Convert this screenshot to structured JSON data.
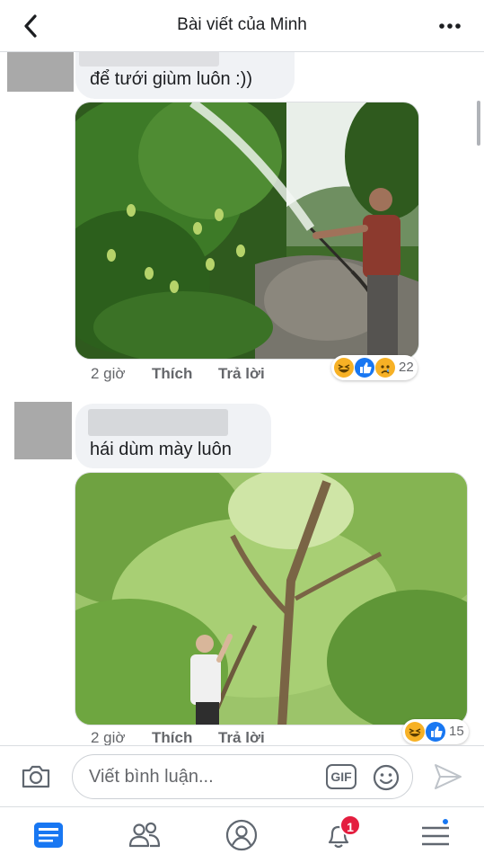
{
  "header": {
    "title": "Bài viết của Minh"
  },
  "comments": [
    {
      "text": "để tưới giùm luôn :))",
      "photo_description": "mango-tree-watering-photo",
      "time": "2 giờ",
      "like_label": "Thích",
      "reply_label": "Trả lời",
      "reactions": [
        "haha",
        "like",
        "sad"
      ],
      "reaction_count": "22"
    },
    {
      "text": "hái dùm mày luôn",
      "photo_description": "mango-tree-climbing-photo",
      "time": "2 giờ",
      "like_label": "Thích",
      "reply_label": "Trả lời",
      "reactions": [
        "haha",
        "like"
      ],
      "reaction_count": "15"
    }
  ],
  "composer": {
    "placeholder": "Viết bình luận...",
    "gif_label": "GIF"
  },
  "tabbar": {
    "notification_badge": "1"
  },
  "colors": {
    "accent": "#1877f2",
    "bubble": "#f0f2f5",
    "badge": "#e41e3f",
    "haha": "#f7b125",
    "like": "#1877f2"
  }
}
